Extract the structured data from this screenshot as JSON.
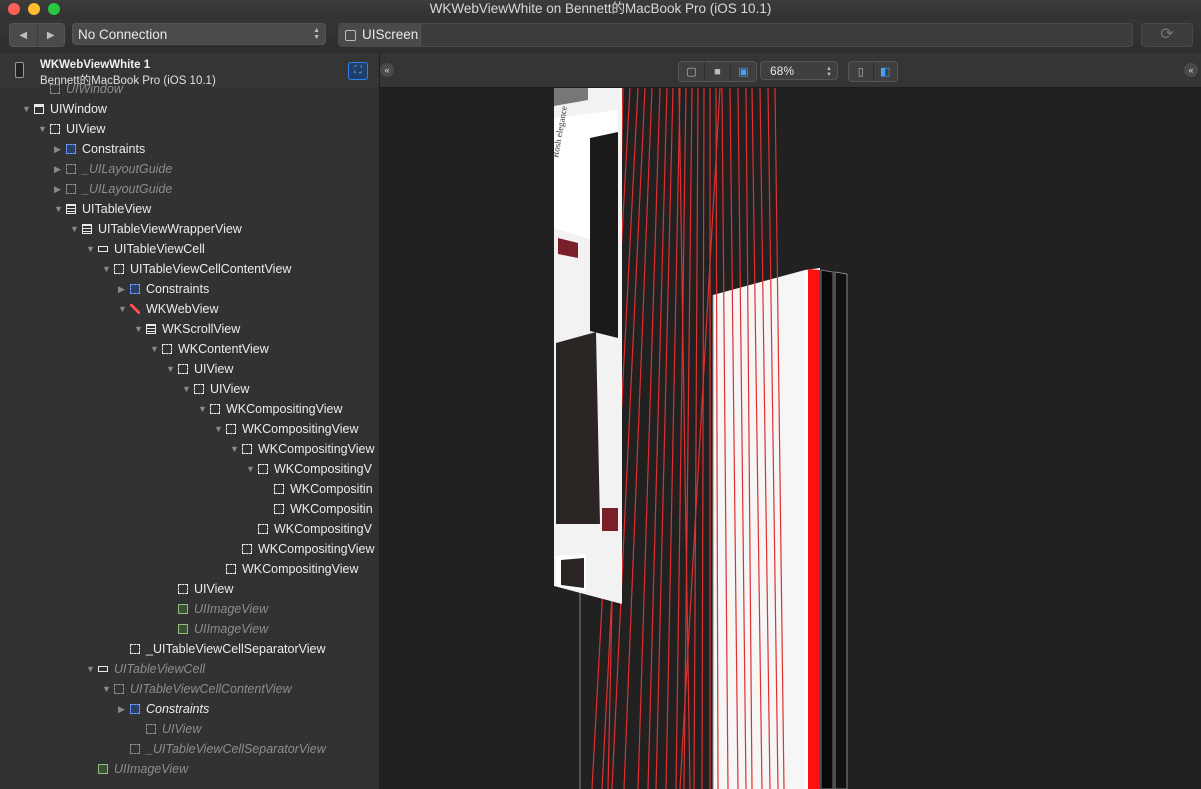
{
  "window": {
    "title": "WKWebViewWhite on Bennett的MacBook Pro (iOS 10.1)"
  },
  "toolbar": {
    "connection": "No Connection",
    "scope_label": "UIScreen"
  },
  "device": {
    "name": "WKWebViewWhite 1",
    "subtitle": "Bennett的MacBook Pro (iOS 10.1)"
  },
  "tree": [
    {
      "label": "UIWindow",
      "icon": "dash-icon",
      "indent": 1,
      "arrow": "",
      "style": "hid"
    },
    {
      "label": "UIWindow",
      "icon": "window-icon",
      "indent": 0,
      "arrow": "down",
      "style": ""
    },
    {
      "label": "UIView",
      "icon": "dash-icon",
      "indent": 1,
      "arrow": "down",
      "style": ""
    },
    {
      "label": "Constraints",
      "icon": "constraints-icon",
      "indent": 2,
      "arrow": "right",
      "style": ""
    },
    {
      "label": "_UILayoutGuide",
      "icon": "dash-icon",
      "indent": 2,
      "arrow": "right",
      "style": "hid"
    },
    {
      "label": "_UILayoutGuide",
      "icon": "dash-icon",
      "indent": 2,
      "arrow": "right",
      "style": "hid"
    },
    {
      "label": "UITableView",
      "icon": "table-icon",
      "indent": 2,
      "arrow": "down",
      "style": ""
    },
    {
      "label": "UITableViewWrapperView",
      "icon": "table-icon",
      "indent": 3,
      "arrow": "down",
      "style": ""
    },
    {
      "label": "UITableViewCell",
      "icon": "cell-icon",
      "indent": 4,
      "arrow": "down",
      "style": ""
    },
    {
      "label": "UITableViewCellContentView",
      "icon": "dash-icon",
      "indent": 5,
      "arrow": "down",
      "style": ""
    },
    {
      "label": "Constraints",
      "icon": "constraints-icon",
      "indent": 6,
      "arrow": "right",
      "style": ""
    },
    {
      "label": "WKWebView",
      "icon": "compass-icon",
      "indent": 6,
      "arrow": "down",
      "style": ""
    },
    {
      "label": "WKScrollView",
      "icon": "table-icon",
      "indent": 7,
      "arrow": "down",
      "style": ""
    },
    {
      "label": "WKContentView",
      "icon": "dash-icon",
      "indent": 8,
      "arrow": "down",
      "style": ""
    },
    {
      "label": "UIView",
      "icon": "dash-icon",
      "indent": 9,
      "arrow": "down",
      "style": ""
    },
    {
      "label": "UIView",
      "icon": "dash-icon",
      "indent": 10,
      "arrow": "down",
      "style": ""
    },
    {
      "label": "WKCompositingView",
      "icon": "dash-icon",
      "indent": 11,
      "arrow": "down",
      "style": ""
    },
    {
      "label": "WKCompositingView",
      "icon": "dash-icon",
      "indent": 12,
      "arrow": "down",
      "style": ""
    },
    {
      "label": "WKCompositingView",
      "icon": "dash-icon",
      "indent": 13,
      "arrow": "down",
      "style": ""
    },
    {
      "label": "WKCompositingV",
      "icon": "dash-icon",
      "indent": 14,
      "arrow": "down",
      "style": ""
    },
    {
      "label": "WKCompositin",
      "icon": "dash-icon",
      "indent": 15,
      "arrow": "",
      "style": ""
    },
    {
      "label": "WKCompositin",
      "icon": "dash-icon",
      "indent": 15,
      "arrow": "",
      "style": ""
    },
    {
      "label": "WKCompositingV",
      "icon": "dash-icon",
      "indent": 14,
      "arrow": "",
      "style": ""
    },
    {
      "label": "WKCompositingView",
      "icon": "dash-icon",
      "indent": 13,
      "arrow": "",
      "style": ""
    },
    {
      "label": "WKCompositingView",
      "icon": "dash-icon",
      "indent": 12,
      "arrow": "",
      "style": ""
    },
    {
      "label": "UIView",
      "icon": "dash-icon",
      "indent": 9,
      "arrow": "",
      "style": ""
    },
    {
      "label": "UIImageView",
      "icon": "image-icon",
      "indent": 9,
      "arrow": "",
      "style": "hid"
    },
    {
      "label": "UIImageView",
      "icon": "image-icon",
      "indent": 9,
      "arrow": "",
      "style": "hid"
    },
    {
      "label": "_UITableViewCellSeparatorView",
      "icon": "dash-icon",
      "indent": 6,
      "arrow": "",
      "style": ""
    },
    {
      "label": "UITableViewCell",
      "icon": "cell-icon",
      "indent": 4,
      "arrow": "down",
      "style": "hid"
    },
    {
      "label": "UITableViewCellContentView",
      "icon": "dash-icon",
      "indent": 5,
      "arrow": "down",
      "style": "hid"
    },
    {
      "label": "Constraints",
      "icon": "constraints-icon",
      "indent": 6,
      "arrow": "right",
      "style": "bi"
    },
    {
      "label": "UIView",
      "icon": "dash-icon",
      "indent": 7,
      "arrow": "",
      "style": "hid"
    },
    {
      "label": "_UITableViewCellSeparatorView",
      "icon": "dash-icon",
      "indent": 6,
      "arrow": "",
      "style": "hid"
    },
    {
      "label": "UIImageView",
      "icon": "image-icon",
      "indent": 4,
      "arrow": "",
      "style": "hid"
    }
  ],
  "canvas": {
    "zoom": "68%",
    "accent_color": "#e03030",
    "selection_color": "#3fa2ff",
    "mockup_caption": "Rosh elegance"
  }
}
